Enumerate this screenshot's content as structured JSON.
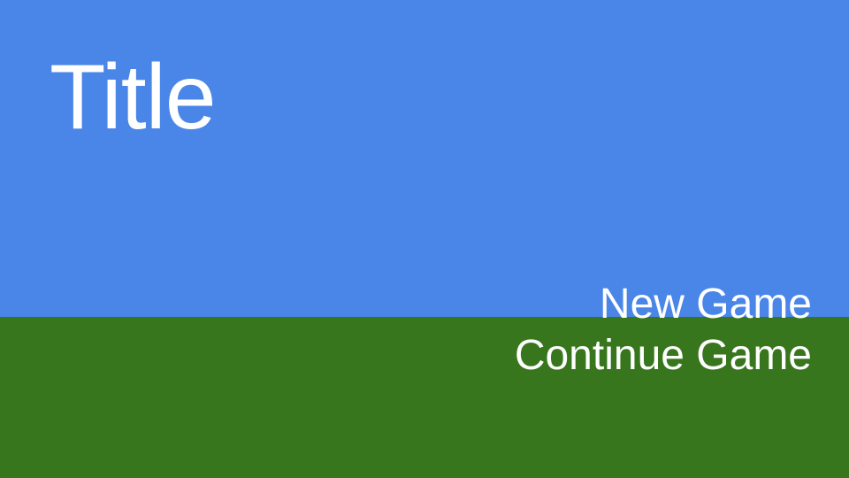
{
  "screen": {
    "title": "Title",
    "colors": {
      "sky": "#4a86e8",
      "ground": "#38761d",
      "text": "#ffffff"
    }
  },
  "menu": {
    "items": [
      {
        "label": "New Game"
      },
      {
        "label": "Continue Game"
      }
    ]
  }
}
